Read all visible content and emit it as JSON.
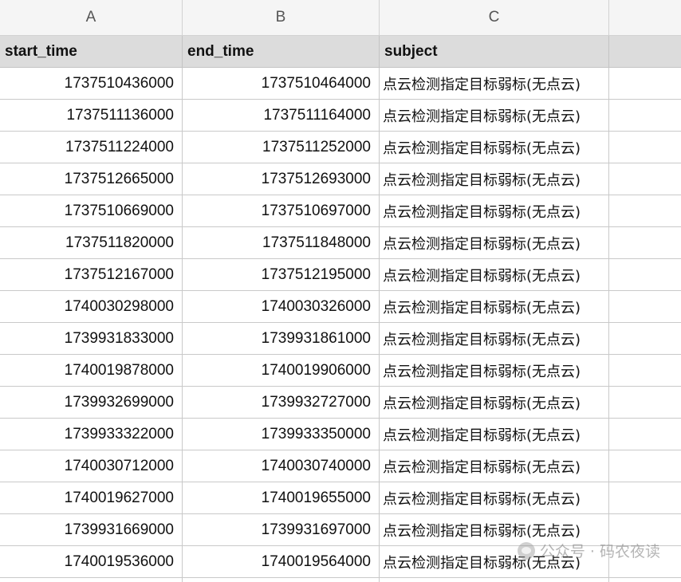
{
  "columns": [
    "A",
    "B",
    "C"
  ],
  "fields": {
    "start_time": "start_time",
    "end_time": "end_time",
    "subject": "subject"
  },
  "rows": [
    {
      "start_time": "1737510436000",
      "end_time": "1737510464000",
      "subject": "点云检测指定目标弱标(无点云)"
    },
    {
      "start_time": "1737511136000",
      "end_time": "1737511164000",
      "subject": "点云检测指定目标弱标(无点云)"
    },
    {
      "start_time": "1737511224000",
      "end_time": "1737511252000",
      "subject": "点云检测指定目标弱标(无点云)"
    },
    {
      "start_time": "1737512665000",
      "end_time": "1737512693000",
      "subject": "点云检测指定目标弱标(无点云)"
    },
    {
      "start_time": "1737510669000",
      "end_time": "1737510697000",
      "subject": "点云检测指定目标弱标(无点云)"
    },
    {
      "start_time": "1737511820000",
      "end_time": "1737511848000",
      "subject": "点云检测指定目标弱标(无点云)"
    },
    {
      "start_time": "1737512167000",
      "end_time": "1737512195000",
      "subject": "点云检测指定目标弱标(无点云)"
    },
    {
      "start_time": "1740030298000",
      "end_time": "1740030326000",
      "subject": "点云检测指定目标弱标(无点云)"
    },
    {
      "start_time": "1739931833000",
      "end_time": "1739931861000",
      "subject": "点云检测指定目标弱标(无点云)"
    },
    {
      "start_time": "1740019878000",
      "end_time": "1740019906000",
      "subject": "点云检测指定目标弱标(无点云)"
    },
    {
      "start_time": "1739932699000",
      "end_time": "1739932727000",
      "subject": "点云检测指定目标弱标(无点云)"
    },
    {
      "start_time": "1739933322000",
      "end_time": "1739933350000",
      "subject": "点云检测指定目标弱标(无点云)"
    },
    {
      "start_time": "1740030712000",
      "end_time": "1740030740000",
      "subject": "点云检测指定目标弱标(无点云)"
    },
    {
      "start_time": "1740019627000",
      "end_time": "1740019655000",
      "subject": "点云检测指定目标弱标(无点云)"
    },
    {
      "start_time": "1739931669000",
      "end_time": "1739931697000",
      "subject": "点云检测指定目标弱标(无点云)"
    },
    {
      "start_time": "1740019536000",
      "end_time": "1740019564000",
      "subject": "点云检测指定目标弱标(无点云)"
    }
  ],
  "watermark": {
    "prefix": "公众号 ·",
    "name": "码农夜读",
    "icon": "wechat-icon"
  }
}
